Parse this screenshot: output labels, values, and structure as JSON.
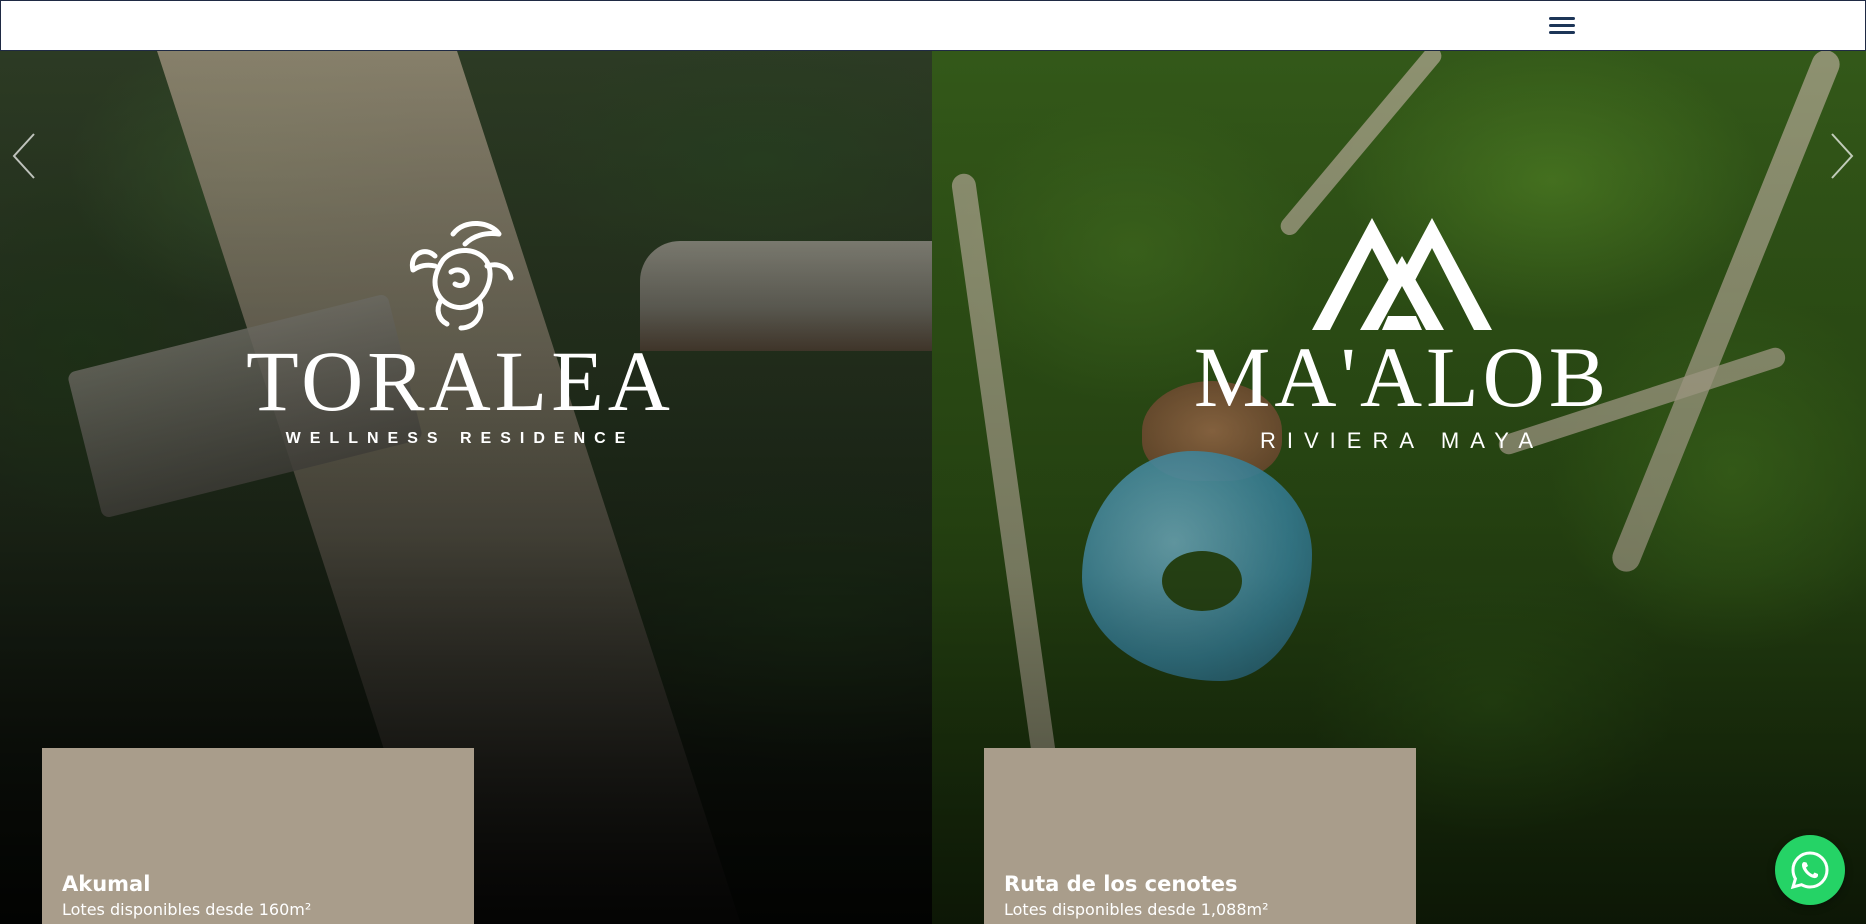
{
  "header": {
    "menu_icon": "hamburger-menu-icon"
  },
  "slider": {
    "prev_icon": "chevron-left-icon",
    "next_icon": "chevron-right-icon",
    "slides": [
      {
        "brand": "TORALEA",
        "tagline": "WELLNESS RESIDENCE",
        "logo_icon": "turtle-logo-icon",
        "location": "Akumal",
        "description": "Lotes disponibles desde 160m²"
      },
      {
        "brand": "MA'ALOB",
        "tagline": "RIVIERA MAYA",
        "logo_icon": "mountain-logo-icon",
        "location": "Ruta de los cenotes",
        "description": "Lotes disponibles desde 1,088m²"
      }
    ]
  },
  "whatsapp": {
    "icon": "whatsapp-icon"
  },
  "colors": {
    "card_bg": "#a99d8b",
    "whatsapp_green": "#25d366",
    "menu_navy": "#1d3557"
  }
}
